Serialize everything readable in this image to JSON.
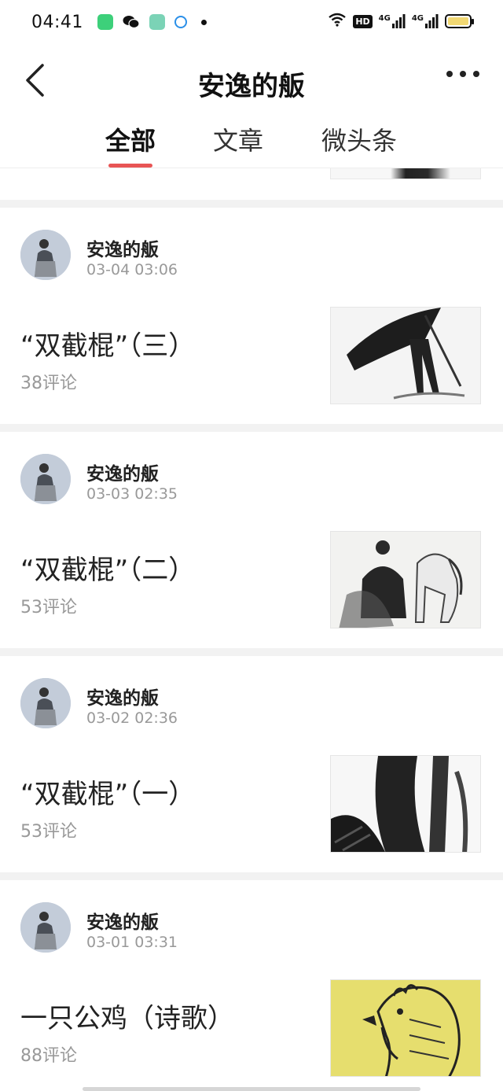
{
  "status_bar": {
    "time": "04:41",
    "hd_label": "HD",
    "signal_1": "4G",
    "signal_2": "4G"
  },
  "header": {
    "title": "安逸的舨"
  },
  "tabs": [
    {
      "label": "全部",
      "active": true
    },
    {
      "label": "文章",
      "active": false
    },
    {
      "label": "微头条",
      "active": false
    }
  ],
  "posts": [
    {
      "author": "安逸的舨",
      "time": "03-04 03:06",
      "title": "“双截棍”（三）",
      "comments": "38评论",
      "thumb_icon": "ink-swordsman-image"
    },
    {
      "author": "安逸的舨",
      "time": "03-03 02:35",
      "title": "“双截棍”（二）",
      "comments": "53评论",
      "thumb_icon": "ink-horseman-image"
    },
    {
      "author": "安逸的舨",
      "time": "03-02 02:36",
      "title": "“双截棍”（一）",
      "comments": "53评论",
      "thumb_icon": "ink-warrior-image"
    },
    {
      "author": "安逸的舨",
      "time": "03-01 03:31",
      "title": "一只公鸡（诗歌）",
      "comments": "88评论",
      "thumb_icon": "rooster-sketch-image"
    }
  ],
  "colors": {
    "tab_indicator": "#e85555",
    "separator": "#f2f2f2",
    "meta_text": "#999999",
    "rooster_bg": "#e8e070"
  }
}
